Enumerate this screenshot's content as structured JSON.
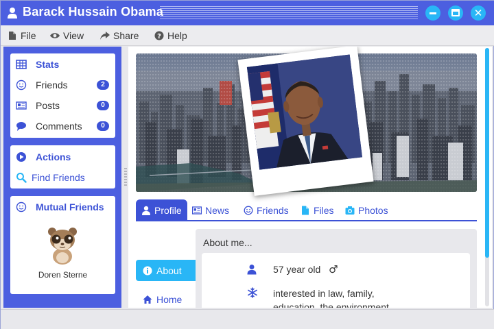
{
  "window": {
    "title": "Barack Hussain Obama",
    "accent": "#4c5fe0",
    "highlight": "#29b6f6"
  },
  "menubar": {
    "items": [
      {
        "label": "File",
        "icon": "file-icon"
      },
      {
        "label": "View",
        "icon": "eye-icon"
      },
      {
        "label": "Share",
        "icon": "share-icon"
      },
      {
        "label": "Help",
        "icon": "help-icon"
      }
    ]
  },
  "sidebar": {
    "stats": {
      "heading": "Stats",
      "items": [
        {
          "label": "Friends",
          "count": "2"
        },
        {
          "label": "Posts",
          "count": "0"
        },
        {
          "label": "Comments",
          "count": "0"
        }
      ]
    },
    "actions": {
      "heading": "Actions",
      "items": [
        {
          "label": "Find Friends"
        }
      ]
    },
    "mutual": {
      "heading": "Mutual Friends",
      "friends": [
        {
          "name": "Doren Sterne"
        }
      ]
    }
  },
  "tabs": [
    {
      "label": "Profile",
      "active": true
    },
    {
      "label": "News"
    },
    {
      "label": "Friends"
    },
    {
      "label": "Files"
    },
    {
      "label": "Photos"
    }
  ],
  "profile_nav": [
    {
      "label": "About",
      "active": true
    },
    {
      "label": "Home"
    }
  ],
  "about": {
    "title": "About me...",
    "age": "57 year old",
    "gender_symbol": "♂",
    "interests_line1": "interested in law, family,",
    "interests_line2": "education, the environment"
  }
}
